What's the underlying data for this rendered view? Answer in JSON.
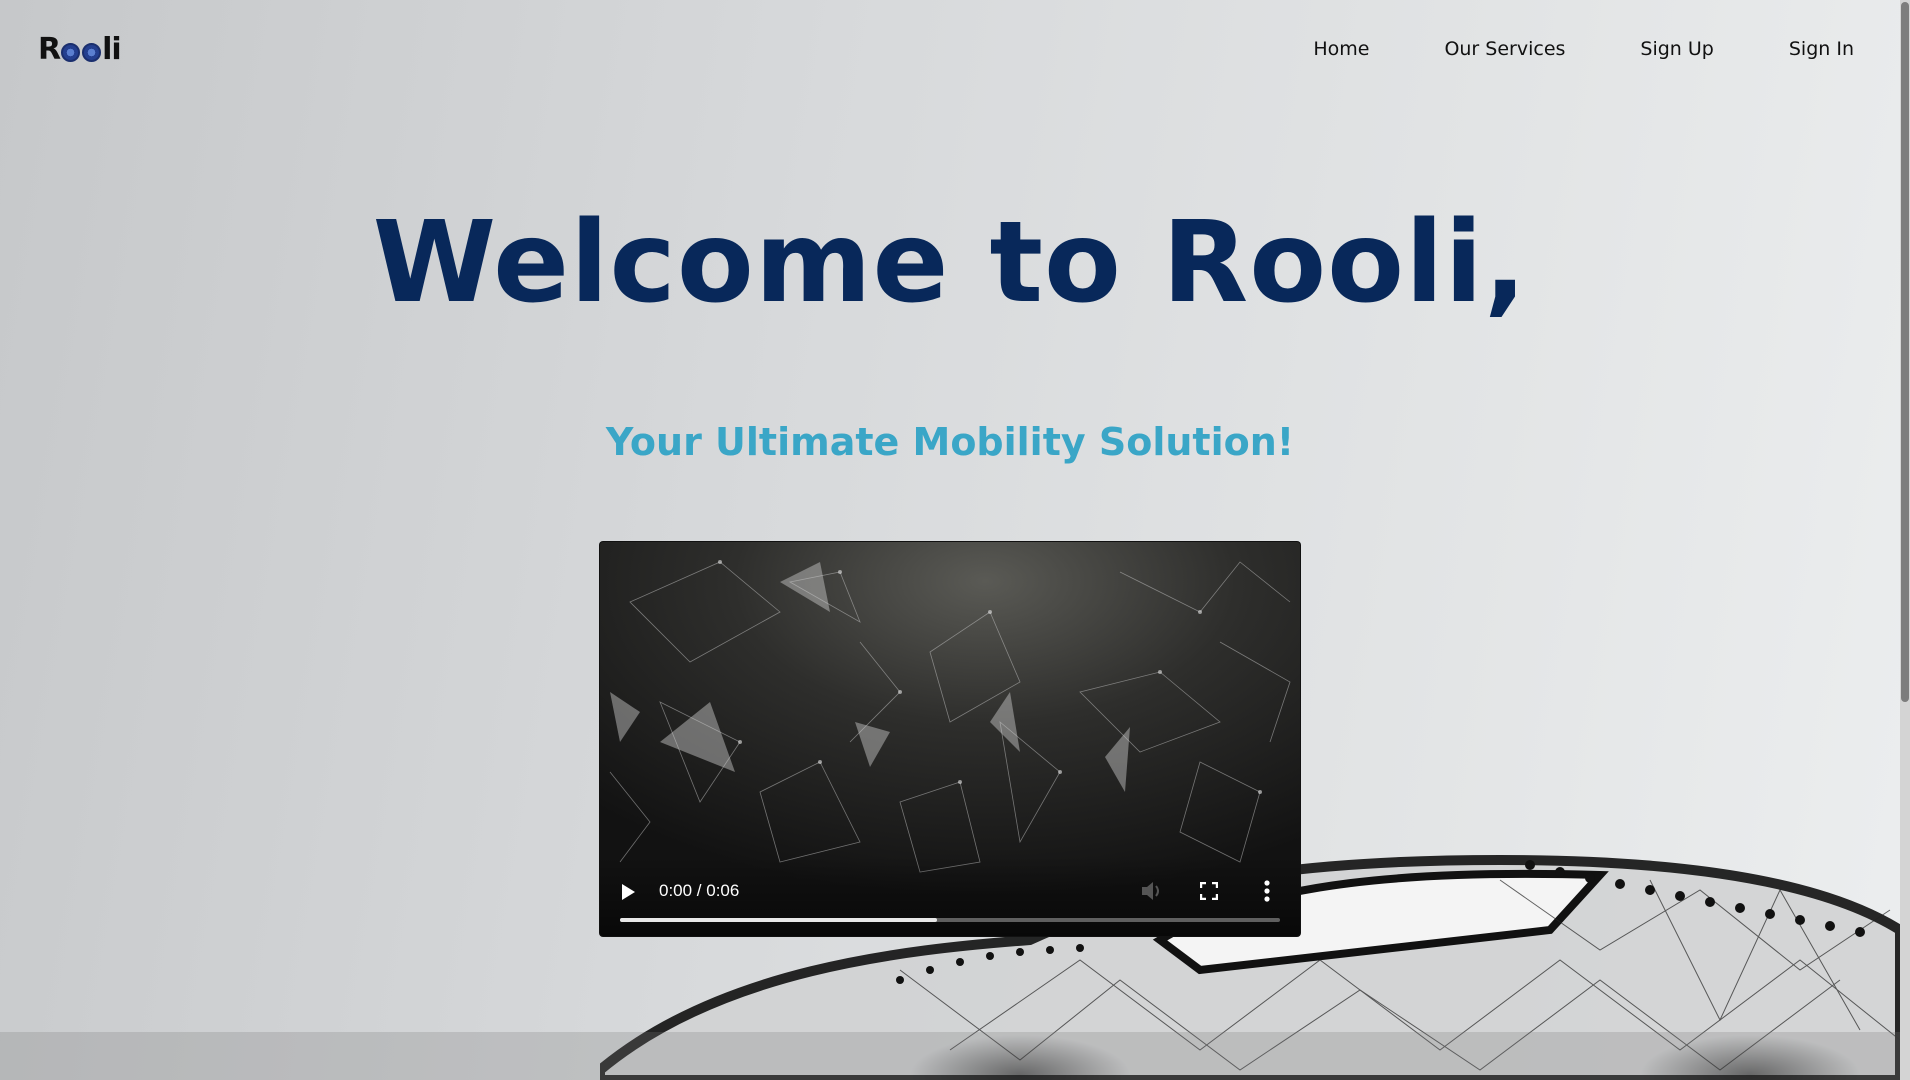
{
  "nav": {
    "logo_text": "Rooli",
    "links": [
      "Home",
      "Our Services",
      "Sign Up",
      "Sign In"
    ]
  },
  "hero": {
    "title": "Welcome to Rooli,",
    "subtitle": "Your Ultimate Mobility Solution!"
  },
  "video": {
    "time": "0:00 / 0:06",
    "buffered_fraction": 0.48
  },
  "colors": {
    "title": "#08285a",
    "subtitle": "#3aa6c7"
  }
}
